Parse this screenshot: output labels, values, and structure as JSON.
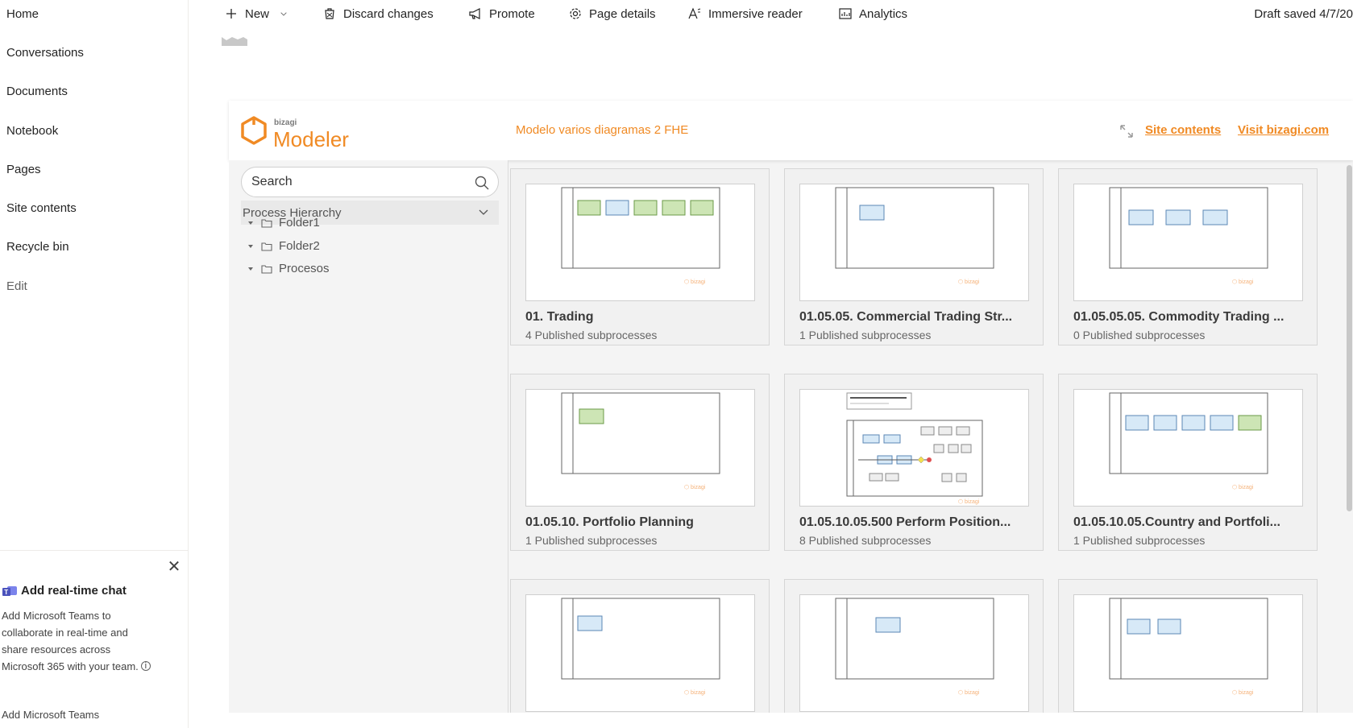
{
  "nav": {
    "items": [
      "Home",
      "Conversations",
      "Documents",
      "Notebook",
      "Pages",
      "Site contents",
      "Recycle bin",
      "Edit"
    ]
  },
  "teams": {
    "title": "Add real-time chat",
    "description": "Add Microsoft Teams to collaborate in real-time and share resources across Microsoft 365 with your team.",
    "info_icon": "info-icon",
    "link": "Add Microsoft Teams"
  },
  "commandbar": {
    "new": "New",
    "discard": "Discard changes",
    "promote": "Promote",
    "page_details": "Page details",
    "immersive_reader": "Immersive reader",
    "analytics": "Analytics",
    "draft_status": "Draft saved 4/7/20"
  },
  "bizagi": {
    "logo_small": "bizagi",
    "logo_name": "Modeler",
    "model_title": "Modelo varios diagramas 2 FHE",
    "site_contents": "Site contents",
    "visit": "Visit bizagi.com",
    "accent_color": "#f08a24",
    "search_placeholder": "Search",
    "hierarchy_label": "Process Hierarchy",
    "tree": [
      "Folder1",
      "Folder2",
      "Procesos"
    ],
    "cards": [
      {
        "title": "01. Trading",
        "subtitle": "4 Published subprocesses"
      },
      {
        "title": "01.05.05. Commercial Trading Str...",
        "subtitle": "1 Published subprocesses"
      },
      {
        "title": "01.05.05.05. Commodity Trading ...",
        "subtitle": "0 Published subprocesses"
      },
      {
        "title": "01.05.10. Portfolio Planning",
        "subtitle": "1 Published subprocesses"
      },
      {
        "title": "01.05.10.05.500 Perform Position...",
        "subtitle": "8 Published subprocesses"
      },
      {
        "title": "01.05.10.05.Country and Portfoli...",
        "subtitle": "1 Published subprocesses"
      },
      {
        "title": "",
        "subtitle": ""
      },
      {
        "title": "",
        "subtitle": ""
      },
      {
        "title": "",
        "subtitle": ""
      }
    ]
  }
}
